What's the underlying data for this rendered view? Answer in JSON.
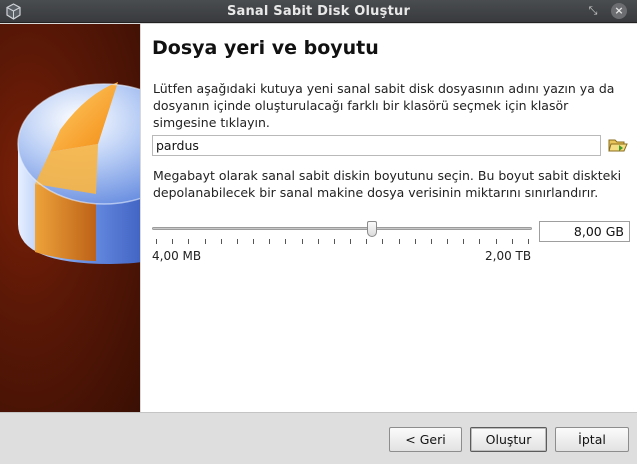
{
  "window": {
    "title": "Sanal Sabit Disk Oluştur",
    "restore_glyph": "⤡",
    "close_glyph": "×"
  },
  "page": {
    "title": "Dosya yeri ve boyutu",
    "location_text": "Lütfen aşağıdaki kutuya yeni sanal sabit disk dosyasının adını yazın ya da dosyanın içinde oluşturulacağı farklı bir klasörü seçmek için klasör simgesine tıklayın.",
    "file_name_value": "pardus",
    "size_text": "Megabayt olarak sanal sabit diskin boyutunu seçin. Bu boyut sabit diskteki depolanabilecek bir sanal makine dosya verisinin miktarını sınırlandırır.",
    "size_value": "8,00 GB",
    "range_min": "4,00 MB",
    "range_max": "2,00 TB",
    "slider_fraction": 0.58
  },
  "buttons": {
    "back_label": "< Geri",
    "create_label": "Oluştur",
    "cancel_label": "İptal"
  },
  "icons": {
    "app": "virtualbox-icon",
    "folder": "folder-open-icon"
  },
  "colors": {
    "banner": "#5b1806",
    "accent_orange": "#f7a235",
    "disk_blue": "#4d79d6"
  }
}
